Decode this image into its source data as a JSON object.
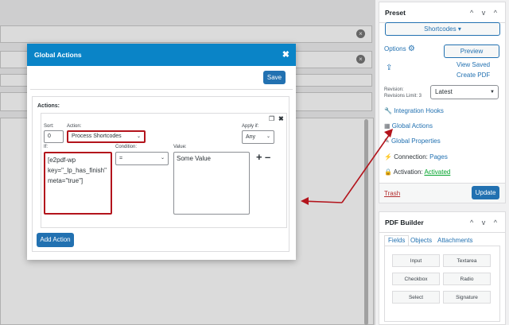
{
  "modal": {
    "title": "Global Actions",
    "close_glyph": "✖",
    "save_label": "Save",
    "actions_label": "Actions:",
    "add_action_label": "Add Action",
    "row": {
      "sort_label": "Sort:",
      "sort_value": "0",
      "action_label": "Action:",
      "action_value": "Process Shortcodes",
      "apply_if_label": "Apply if:",
      "apply_if_value": "Any",
      "if_label": "If:",
      "if_lines": [
        "[e2pdf-wp",
        "key=\"_lp_has_finish\"",
        "meta=\"true\"]"
      ],
      "condition_label": "Condition:",
      "condition_value": "=",
      "value_label": "Value:",
      "value_text": "Some Value",
      "plus": "+",
      "minus": "–",
      "copy_glyph": "❐",
      "remove_glyph": "✖"
    }
  },
  "preset": {
    "title": "Preset",
    "controls": "^ v ^",
    "shortcodes_label": "Shortcodes",
    "options_label": "Options",
    "preview_label": "Preview",
    "view_saved_label": "View Saved",
    "create_pdf_label": "Create PDF",
    "revision_label": "Revision:",
    "revisions_limit_label": "Revisions Limit: 3",
    "revision_value": "Latest",
    "menu": [
      {
        "icon": "wrench-icon",
        "glyph": "🔧",
        "label": "Integration Hooks"
      },
      {
        "icon": "table-icon",
        "glyph": "▦",
        "label": "Global Actions"
      },
      {
        "icon": "brush-icon",
        "glyph": "✎",
        "label": "Global Properties"
      }
    ],
    "connection_label": "Connection:",
    "connection_value": "Pages",
    "activation_label": "Activation:",
    "activation_value": "Activated",
    "trash_label": "Trash",
    "update_label": "Update"
  },
  "pdf_builder": {
    "title": "PDF Builder",
    "controls": "^ v ^",
    "tabs": [
      "Fields",
      "Objects",
      "Attachments"
    ],
    "fields": [
      "Input",
      "Textarea",
      "Checkbox",
      "Radio",
      "Select",
      "Signature"
    ]
  },
  "colors": {
    "accent": "#2271b1",
    "modal_header": "#0a84c7",
    "highlight": "#b3141c",
    "activated": "#00a32a"
  }
}
